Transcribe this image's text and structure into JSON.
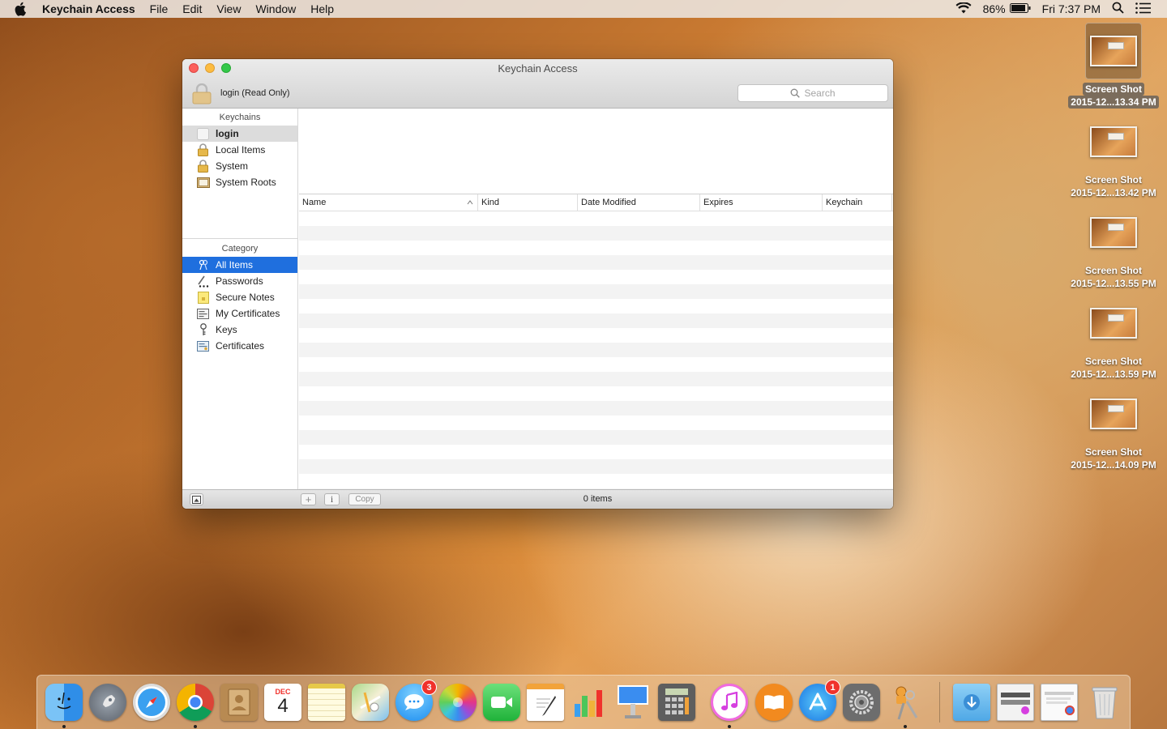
{
  "menubar": {
    "app_name": "Keychain Access",
    "menus": [
      "File",
      "Edit",
      "View",
      "Window",
      "Help"
    ],
    "battery": "86%",
    "clock": "Fri 7:37 PM"
  },
  "desktop_icons": [
    {
      "line1": "Screen Shot",
      "line2": "2015-12...13.34 PM",
      "selected": true
    },
    {
      "line1": "Screen Shot",
      "line2": "2015-12...13.42 PM"
    },
    {
      "line1": "Screen Shot",
      "line2": "2015-12...13.55 PM"
    },
    {
      "line1": "Screen Shot",
      "line2": "2015-12...13.59 PM"
    },
    {
      "line1": "Screen Shot",
      "line2": "2015-12...14.09 PM"
    }
  ],
  "window": {
    "title": "Keychain Access",
    "lock_label": "login (Read Only)",
    "search_placeholder": "Search",
    "keychains_header": "Keychains",
    "keychains": [
      {
        "label": "login",
        "icon": "keychain-empty-icon"
      },
      {
        "label": "Local Items",
        "icon": "lock-icon"
      },
      {
        "label": "System",
        "icon": "lock-icon"
      },
      {
        "label": "System Roots",
        "icon": "roots-folder-icon"
      }
    ],
    "category_header": "Category",
    "categories": [
      {
        "label": "All Items",
        "icon": "all-items-icon"
      },
      {
        "label": "Passwords",
        "icon": "passwords-icon"
      },
      {
        "label": "Secure Notes",
        "icon": "secure-note-icon"
      },
      {
        "label": "My Certificates",
        "icon": "my-certificate-icon"
      },
      {
        "label": "Keys",
        "icon": "key-icon"
      },
      {
        "label": "Certificates",
        "icon": "certificate-icon"
      }
    ],
    "columns": [
      "Name",
      "Kind",
      "Date Modified",
      "Expires",
      "Keychain"
    ],
    "footer": {
      "copy_label": "Copy",
      "info_label": "i",
      "add_label": "+",
      "count": "0 items"
    }
  },
  "dock": {
    "apps": [
      {
        "name": "Finder",
        "running": true
      },
      {
        "name": "Launchpad"
      },
      {
        "name": "Safari"
      },
      {
        "name": "Google Chrome",
        "running": true
      },
      {
        "name": "Contacts"
      },
      {
        "name": "Calendar",
        "month": "DEC",
        "day": "4"
      },
      {
        "name": "Notes"
      },
      {
        "name": "Maps"
      },
      {
        "name": "Messages",
        "badge": "3"
      },
      {
        "name": "Photos"
      },
      {
        "name": "FaceTime"
      },
      {
        "name": "Pages"
      },
      {
        "name": "Numbers"
      },
      {
        "name": "Keynote"
      },
      {
        "name": "Calculator"
      },
      {
        "name": "iTunes",
        "running": true
      },
      {
        "name": "iBooks"
      },
      {
        "name": "App Store",
        "badge": "1"
      },
      {
        "name": "System Preferences"
      },
      {
        "name": "Keychain Access",
        "running": true
      },
      {
        "name": "Downloads"
      },
      {
        "name": "Recent Screenshots"
      },
      {
        "name": "Recent Windows"
      },
      {
        "name": "Trash"
      }
    ]
  }
}
